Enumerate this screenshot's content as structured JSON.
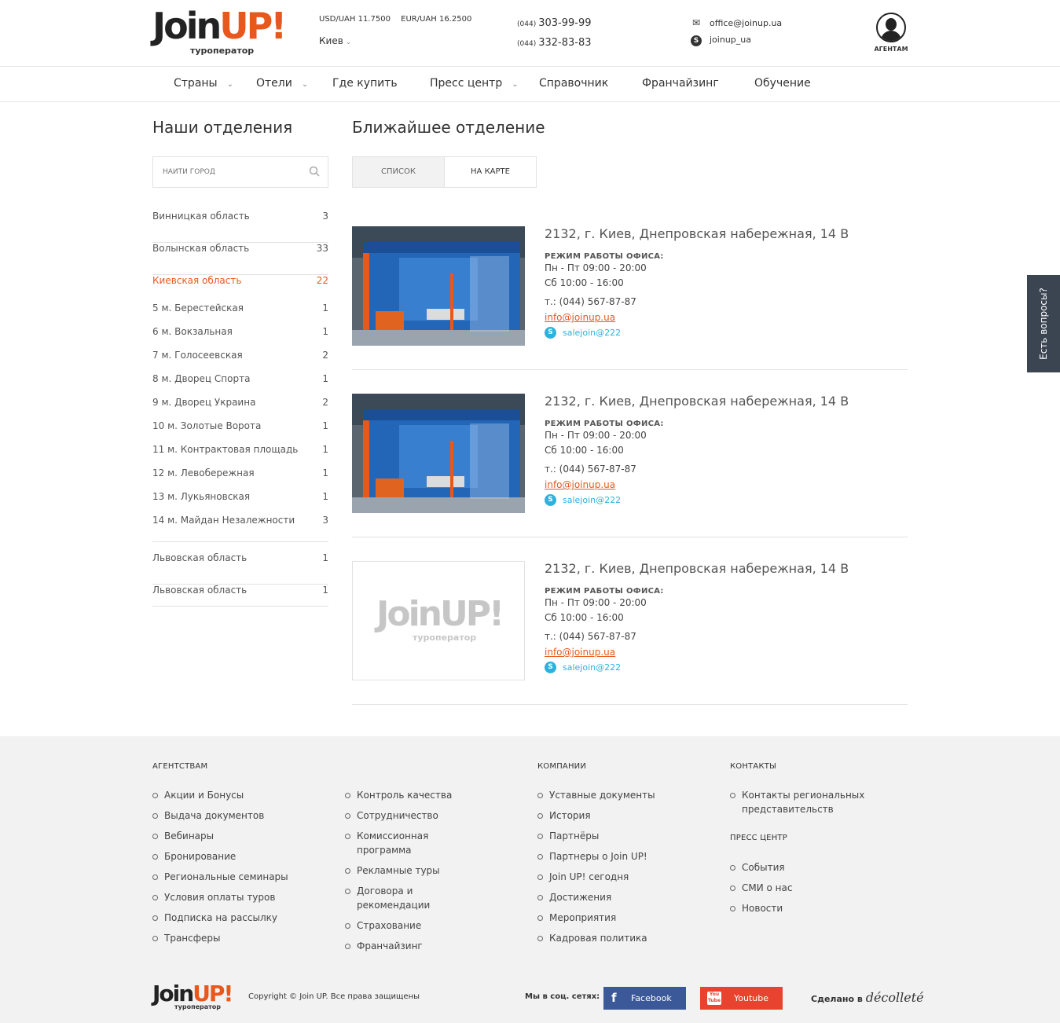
{
  "header": {
    "logo": {
      "main": "Join",
      "accent": "UP!",
      "sub": "туроператор"
    },
    "rates": [
      "USD/UAH 11.7500",
      "EUR/UAH 16.2500"
    ],
    "city": "Киев",
    "phones": [
      {
        "code": "(044)",
        "number": "303-99-99"
      },
      {
        "code": "(044)",
        "number": "332-83-83"
      }
    ],
    "email": "office@joinup.ua",
    "skype": "joinup_ua",
    "agent_label": "АГЕНТАМ"
  },
  "nav": [
    "Страны",
    "Отели",
    "Где купить",
    "Пресс центр",
    "Справочник",
    "Франчайзинг",
    "Обучение"
  ],
  "left": {
    "title": "Наши отделения",
    "search_placeholder": "НАЙТИ ГОРОД",
    "regions_top": [
      {
        "name": "Винницкая область",
        "count": "3"
      },
      {
        "name": "Волынская область",
        "count": "33"
      }
    ],
    "active_region": {
      "name": "Киевская область",
      "count": "22"
    },
    "sub_items": [
      {
        "name": "5 м. Берестейская",
        "count": "1"
      },
      {
        "name": "6 м. Вокзальная",
        "count": "1"
      },
      {
        "name": "7 м. Голосеевская",
        "count": "2"
      },
      {
        "name": "8 м. Дворец Спорта",
        "count": "1"
      },
      {
        "name": "9 м. Дворец Украина",
        "count": "2"
      },
      {
        "name": "10 м. Золотые Ворота",
        "count": "1"
      },
      {
        "name": "11 м. Контрактовая площадь",
        "count": "1"
      },
      {
        "name": "12 м. Левобережная",
        "count": "1"
      },
      {
        "name": "13 м. Лукьяновская",
        "count": "1"
      },
      {
        "name": "14 м. Майдан Незалежности",
        "count": "3"
      }
    ],
    "regions_bottom": [
      {
        "name": "Львовская область",
        "count": "1"
      },
      {
        "name": "Львовская область",
        "count": "1"
      }
    ]
  },
  "main": {
    "title": "Ближайшее отделение",
    "tabs": [
      "СПИСОК",
      "НА КАРТЕ"
    ],
    "offices": [
      {
        "address": "2132, г. Киев, Днепровская набережная, 14 В",
        "hours_label": "РЕЖИМ РАБОТЫ ОФИСА:",
        "hours1": "Пн - Пт 09:00 - 20:00",
        "hours2": "Сб 10:00 - 16:00",
        "phone": "т.: (044) 567-87-87",
        "email": "info@joinup.ua",
        "skype": "salejoin@222"
      },
      {
        "address": "2132, г. Киев, Днепровская набережная, 14 В",
        "hours_label": "РЕЖИМ РАБОТЫ ОФИСА:",
        "hours1": "Пн - Пт 09:00 - 20:00",
        "hours2": "Сб 10:00 - 16:00",
        "phone": "т.: (044) 567-87-87",
        "email": "info@joinup.ua",
        "skype": "salejoin@222"
      },
      {
        "address": "2132, г. Киев, Днепровская набережная, 14 В",
        "hours_label": "РЕЖИМ РАБОТЫ ОФИСА:",
        "hours1": "Пн - Пт 09:00 - 20:00",
        "hours2": "Сб 10:00 - 16:00",
        "phone": "т.: (044) 567-87-87",
        "email": "info@joinup.ua",
        "skype": "salejoin@222"
      }
    ]
  },
  "side_tab": "Есть вопросы?",
  "footer": {
    "agencies_title": "АГЕНТСТВАМ",
    "agencies_col1": [
      "Акции и Бонусы",
      "Выдача документов",
      "Вебинары",
      "Бронирование",
      "Региональные семинары",
      "Условия оплаты туров",
      "Подписка на рассылку",
      "Трансферы"
    ],
    "agencies_col2": [
      "Контроль качества",
      "Сотрудничество",
      "Комиссионная программа",
      "Рекламные туры",
      "Договора и рекомендации",
      "Страхование",
      "Франчайзинг"
    ],
    "company_title": "КОМПАНИИ",
    "company": [
      "Уставные документы",
      "История",
      "Партнёры",
      "Партнеры о Join UP!",
      "Join UP! сегодня",
      "Достижения",
      "Мероприятия",
      "Кадровая политика"
    ],
    "contacts_title": "КОНТАКТЫ",
    "contacts": [
      "Контакты региональных представительств"
    ],
    "press_title": "ПРЕСС ЦЕНТР",
    "press": [
      "События",
      "СМИ о нас",
      "Новости"
    ],
    "copyright": "Copyright © Join UP. Все права защищены",
    "social_label": "Мы в соц. сетях:",
    "facebook": "Facebook",
    "youtube": "Youtube",
    "made_by": "Сделано в",
    "made_brand": "décolleté"
  }
}
